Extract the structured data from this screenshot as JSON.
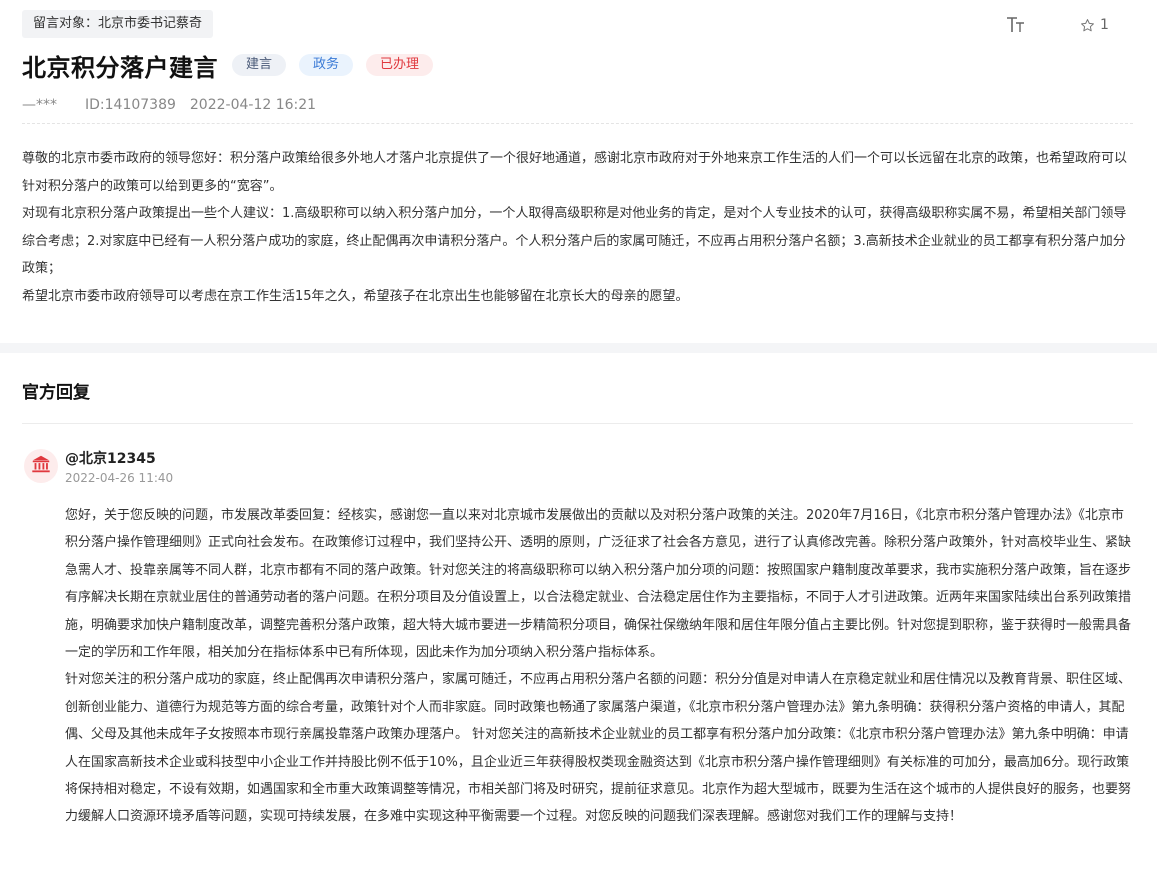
{
  "header": {
    "target_label": "留言对象：北京市委书记蔡奇",
    "font_size_icon": "font-size-icon",
    "favorite_icon": "star-outline-icon",
    "favorite_count": "1"
  },
  "message": {
    "title": "北京积分落户建言",
    "tags": {
      "type": "建言",
      "area": "政务",
      "status": "已办理"
    },
    "author": "—***",
    "id_label": "ID:14107389",
    "datetime": "2022-04-12 16:21",
    "paragraphs": [
      "尊敬的北京市委市政府的领导您好：积分落户政策给很多外地人才落户北京提供了一个很好地通道，感谢北京市政府对于外地来京工作生活的人们一个可以长远留在北京的政策，也希望政府可以针对积分落户的政策可以给到更多的“宽容”。",
      "对现有北京积分落户政策提出一些个人建议：1.高级职称可以纳入积分落户加分，一个人取得高级职称是对他业务的肯定，是对个人专业技术的认可，获得高级职称实属不易，希望相关部门领导综合考虑；2.对家庭中已经有一人积分落户成功的家庭，终止配偶再次申请积分落户。个人积分落户后的家属可随迁，不应再占用积分落户名额；3.高新技术企业就业的员工都享有积分落户加分政策；",
      "希望北京市委市政府领导可以考虑在京工作生活15年之久，希望孩子在北京出生也能够留在北京长大的母亲的愿望。"
    ]
  },
  "reply_section": {
    "heading": "官方回复",
    "avatar_icon": "government-building-icon",
    "replier": "@北京12345",
    "reply_time": "2022-04-26 11:40",
    "paragraphs": [
      "您好，关于您反映的问题，市发展改革委回复：经核实，感谢您一直以来对北京城市发展做出的贡献以及对积分落户政策的关注。2020年7月16日，《北京市积分落户管理办法》《北京市积分落户操作管理细则》正式向社会发布。在政策修订过程中，我们坚持公开、透明的原则，广泛征求了社会各方意见，进行了认真修改完善。除积分落户政策外，针对高校毕业生、紧缺急需人才、投靠亲属等不同人群，北京市都有不同的落户政策。针对您关注的将高级职称可以纳入积分落户加分项的问题：按照国家户籍制度改革要求，我市实施积分落户政策，旨在逐步有序解决长期在京就业居住的普通劳动者的落户问题。在积分项目及分值设置上，以合法稳定就业、合法稳定居住作为主要指标，不同于人才引进政策。近两年来国家陆续出台系列政策措施，明确要求加快户籍制度改革，调整完善积分落户政策，超大特大城市要进一步精简积分项目，确保社保缴纳年限和居住年限分值占主要比例。针对您提到职称，鉴于获得时一般需具备一定的学历和工作年限，相关加分在指标体系中已有所体现，因此未作为加分项纳入积分落户指标体系。",
      "针对您关注的积分落户成功的家庭，终止配偶再次申请积分落户，家属可随迁，不应再占用积分落户名额的问题：积分分值是对申请人在京稳定就业和居住情况以及教育背景、职住区域、创新创业能力、道德行为规范等方面的综合考量，政策针对个人而非家庭。同时政策也畅通了家属落户渠道，《北京市积分落户管理办法》第九条明确：获得积分落户资格的申请人，其配偶、父母及其他未成年子女按照本市现行亲属投靠落户政策办理落户。 针对您关注的高新技术企业就业的员工都享有积分落户加分政策：《北京市积分落户管理办法》第九条中明确：申请人在国家高新技术企业或科技型中小企业工作并持股比例不低于10%，且企业近三年获得股权类现金融资达到《北京市积分落户操作管理细则》有关标准的可加分，最高加6分。现行政策将保持相对稳定，不设有效期，如遇国家和全市重大政策调整等情况，市相关部门将及时研究，提前征求意见。北京作为超大型城市，既要为生活在这个城市的人提供良好的服务，也要努力缓解人口资源环境矛盾等问题，实现可持续发展，在多难中实现这种平衡需要一个过程。对您反映的问题我们深表理解。感谢您对我们工作的理解与支持！"
    ]
  }
}
